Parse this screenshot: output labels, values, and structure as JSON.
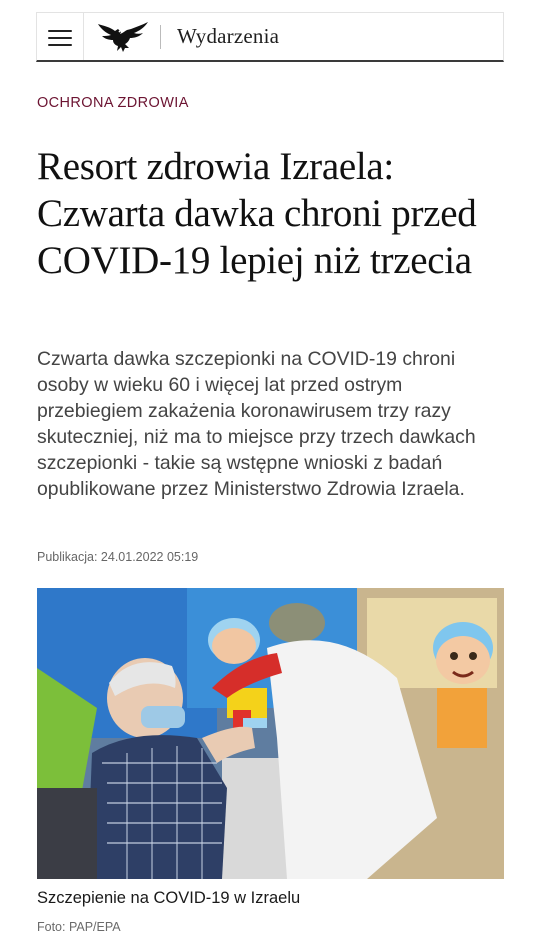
{
  "header": {
    "menu_icon": "hamburger-menu-icon",
    "logo_icon": "eagle-logo-icon",
    "section": "Wydarzenia"
  },
  "article": {
    "category": "OCHRONA ZDROWIA",
    "headline": "Resort zdrowia Izraela: Czwarta dawka chroni przed COVID-19 lepiej niż trzecia",
    "lead": "Czwarta dawka szczepionki na COVID-19 chroni osoby w wieku 60 i więcej lat przed ostrym przebiegiem zakażenia koronawirusem trzy razy skuteczniej, niż ma to miejsce przy trzech dawkach szczepionki - takie są wstępne wnioski z badań opublikowane przez Ministerstwo Zdrowia Izraela.",
    "publication": "Publikacja: 24.01.2022 05:19"
  },
  "photo": {
    "caption": "Szczepienie na COVID-19 w Izraelu",
    "credit": "Foto: PAP/EPA"
  },
  "colors": {
    "category": "#6c1432",
    "header_border": "#3a3a3a",
    "text": "#111111",
    "lead_text": "#444444"
  }
}
